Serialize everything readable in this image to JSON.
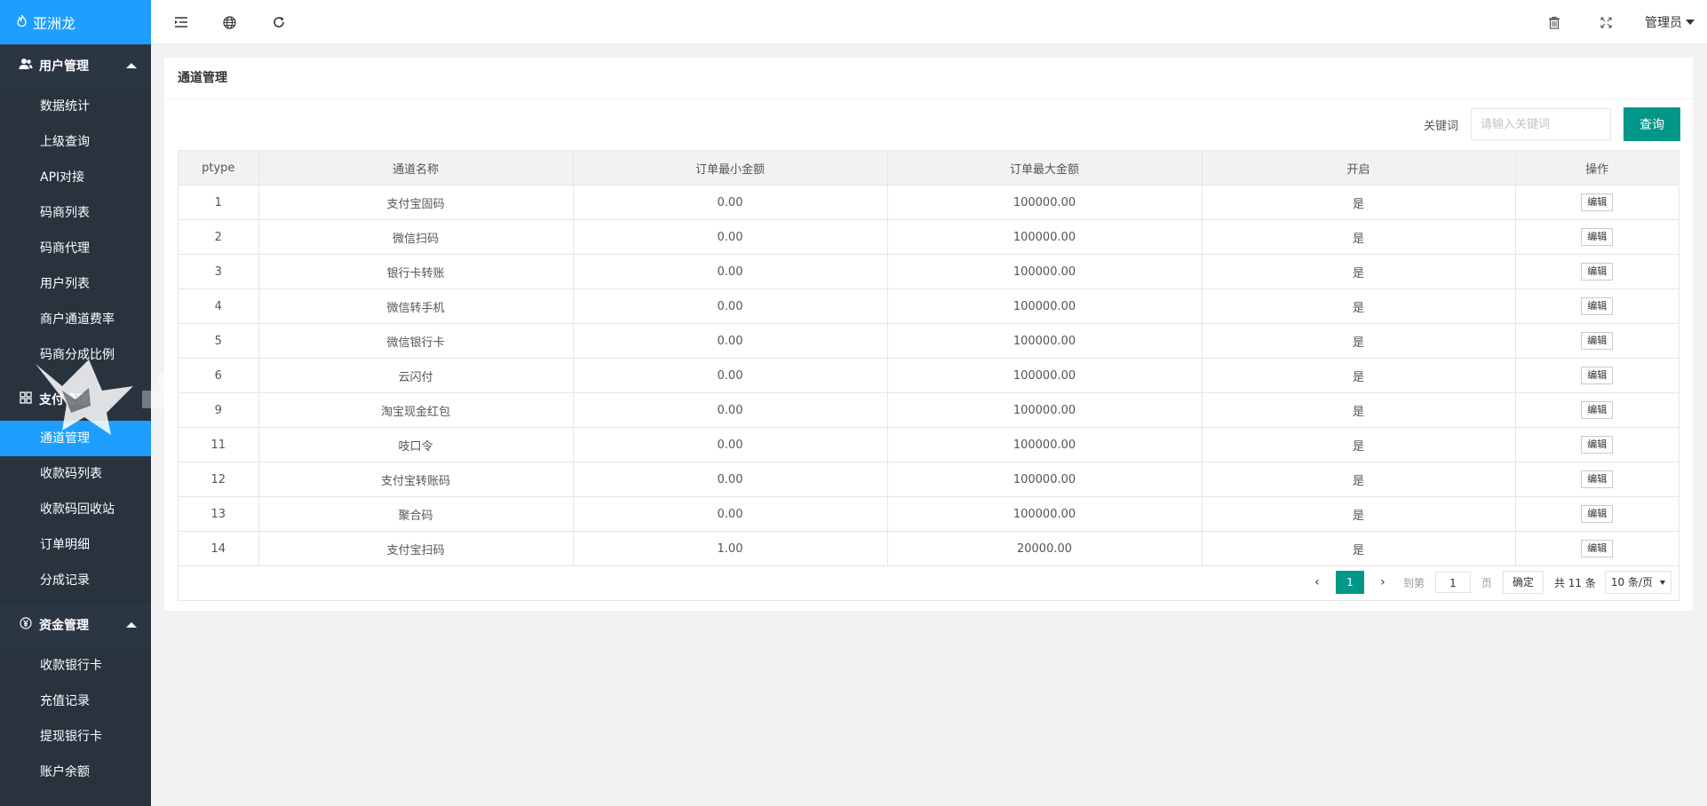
{
  "app": {
    "name": "亚洲龙"
  },
  "sidebar": {
    "groups": [
      {
        "title": "用户管理",
        "icon": "users-icon",
        "items": [
          "数据统计",
          "上级查询",
          "API对接",
          "码商列表",
          "码商代理",
          "用户列表",
          "商户通道费率",
          "码商分成比例"
        ]
      },
      {
        "title": "支付管理",
        "icon": "grid-icon",
        "items": [
          "通道管理",
          "收款码列表",
          "收款码回收站",
          "订单明细",
          "分成记录"
        ],
        "active": "通道管理"
      },
      {
        "title": "资金管理",
        "icon": "yen-icon",
        "items": [
          "收款银行卡",
          "充值记录",
          "提现银行卡",
          "账户余额"
        ]
      }
    ]
  },
  "topbar": {
    "icons": [
      "menu-toggle-icon",
      "globe-icon",
      "refresh-icon",
      "trash-icon",
      "fullscreen-icon"
    ],
    "user": "管理员"
  },
  "page": {
    "title": "通道管理",
    "search": {
      "label": "关键词",
      "placeholder": "请输入关键词",
      "button": "查询"
    }
  },
  "table": {
    "columns": [
      "ptype",
      "通道名称",
      "订单最小金额",
      "订单最大金额",
      "开启",
      "操作"
    ],
    "rows": [
      {
        "ptype": "1",
        "name": "支付宝固码",
        "min": "0.00",
        "max": "100000.00",
        "enabled": "是",
        "action": "编辑"
      },
      {
        "ptype": "2",
        "name": "微信扫码",
        "min": "0.00",
        "max": "100000.00",
        "enabled": "是",
        "action": "编辑"
      },
      {
        "ptype": "3",
        "name": "银行卡转账",
        "min": "0.00",
        "max": "100000.00",
        "enabled": "是",
        "action": "编辑"
      },
      {
        "ptype": "4",
        "name": "微信转手机",
        "min": "0.00",
        "max": "100000.00",
        "enabled": "是",
        "action": "编辑"
      },
      {
        "ptype": "5",
        "name": "微信银行卡",
        "min": "0.00",
        "max": "100000.00",
        "enabled": "是",
        "action": "编辑"
      },
      {
        "ptype": "6",
        "name": "云闪付",
        "min": "0.00",
        "max": "100000.00",
        "enabled": "是",
        "action": "编辑"
      },
      {
        "ptype": "9",
        "name": "淘宝现金红包",
        "min": "0.00",
        "max": "100000.00",
        "enabled": "是",
        "action": "编辑"
      },
      {
        "ptype": "11",
        "name": "吱口令",
        "min": "0.00",
        "max": "100000.00",
        "enabled": "是",
        "action": "编辑"
      },
      {
        "ptype": "12",
        "name": "支付宝转账码",
        "min": "0.00",
        "max": "100000.00",
        "enabled": "是",
        "action": "编辑"
      },
      {
        "ptype": "13",
        "name": "聚合码",
        "min": "0.00",
        "max": "100000.00",
        "enabled": "是",
        "action": "编辑"
      },
      {
        "ptype": "14",
        "name": "支付宝扫码",
        "min": "1.00",
        "max": "20000.00",
        "enabled": "是",
        "action": "编辑"
      }
    ]
  },
  "pagination": {
    "current": "1",
    "goto_label": "到第",
    "page_value": "1",
    "page_unit": "页",
    "confirm": "确定",
    "total": "共 11 条",
    "page_size": "10 条/页"
  },
  "colors": {
    "sidebar": "#28333e",
    "accent_blue": "#1e9fff",
    "accent_green": "#009688"
  }
}
